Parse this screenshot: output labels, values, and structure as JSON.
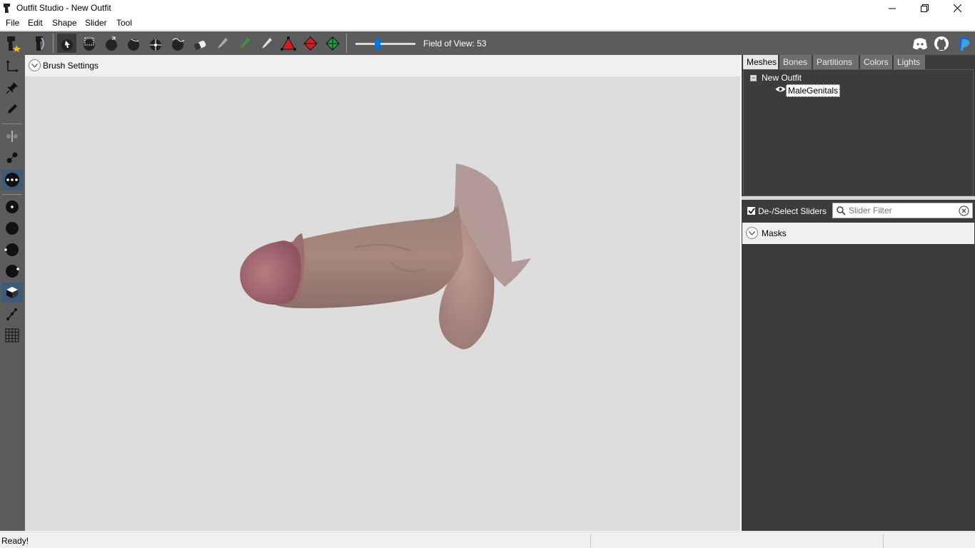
{
  "window": {
    "title": "Outfit Studio - New Outfit"
  },
  "menu": {
    "items": [
      "File",
      "Edit",
      "Shape",
      "Slider",
      "Tool"
    ]
  },
  "toolbar": {
    "fov_label": "Field of View: 53",
    "fov_value": 53,
    "fov_fraction": 0.35,
    "icons": [
      "outfit-studio-icon",
      "bodyslide-icon",
      "select-brush-icon",
      "mask-brush-icon",
      "inflate-brush-icon",
      "deflate-brush-icon",
      "move-brush-icon",
      "smooth-brush-icon",
      "undiff-brush-icon",
      "weight-brush-icon",
      "color-brush-icon",
      "alpha-brush-icon",
      "collapse-vertex-icon",
      "flip-edge-icon",
      "split-edge-icon",
      "discord-icon",
      "github-icon",
      "paypal-icon"
    ]
  },
  "viewport": {
    "brush_settings_label": "Brush Settings"
  },
  "right_panel": {
    "tabs": [
      "Meshes",
      "Bones",
      "Partitions",
      "Colors",
      "Lights"
    ],
    "active_tab": "Meshes",
    "tree": {
      "root": "New Outfit",
      "children": [
        "MaleGenitals"
      ]
    },
    "deselect_sliders_label": "De-/Select Sliders",
    "deselect_checked": true,
    "slider_filter_placeholder": "Slider Filter",
    "masks_label": "Masks"
  },
  "status": {
    "text": "Ready!"
  },
  "colors": {
    "toolbar_bg": "#5c5c5c",
    "panel_bg": "#3c3c3c",
    "viewport_bg": "#dddddd",
    "accent": "#0078d7"
  }
}
